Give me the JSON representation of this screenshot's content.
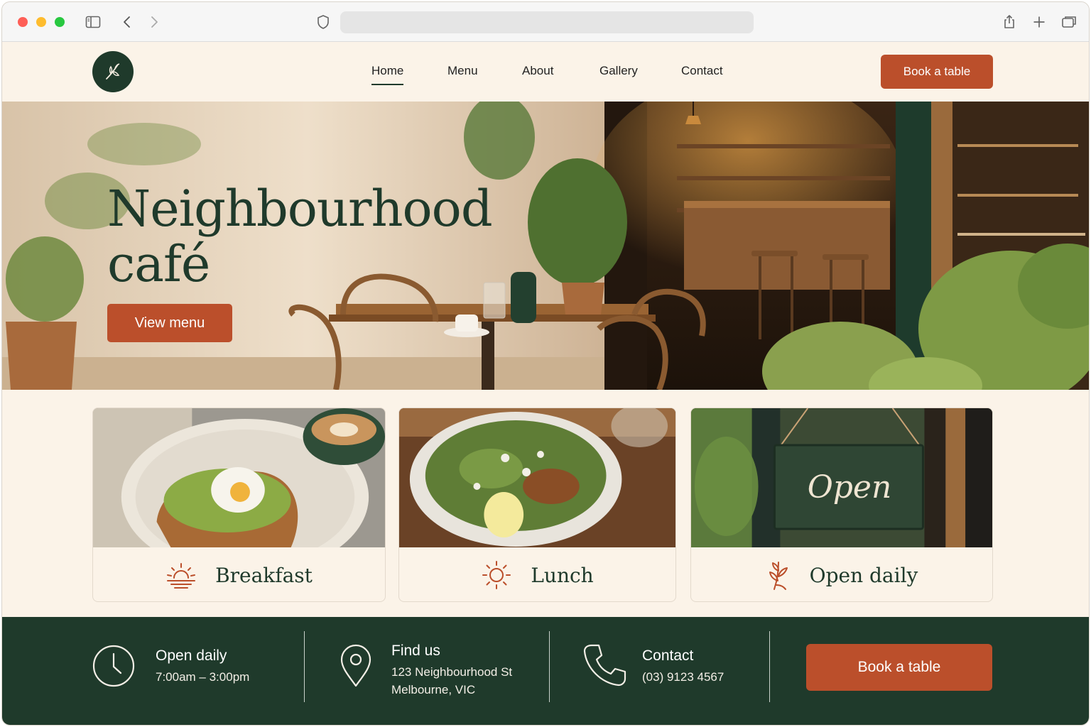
{
  "nav": {
    "items": [
      {
        "label": "Home",
        "active": true
      },
      {
        "label": "Menu",
        "active": false
      },
      {
        "label": "About",
        "active": false
      },
      {
        "label": "Gallery",
        "active": false
      },
      {
        "label": "Contact",
        "active": false
      }
    ],
    "book_label": "Book a table"
  },
  "hero": {
    "title_line1": "Neighbourhood",
    "title_line2": "café",
    "cta_label": "View menu"
  },
  "cards": [
    {
      "label": "Breakfast",
      "icon": "sunrise-icon"
    },
    {
      "label": "Lunch",
      "icon": "sun-icon"
    },
    {
      "label": "Open daily",
      "icon": "leaf-icon"
    }
  ],
  "card_images": {
    "open_sign_text": "Open"
  },
  "info": {
    "hours": {
      "title": "Open daily",
      "text": "7:00am – 3:00pm",
      "icon": "clock-icon"
    },
    "location": {
      "title": "Find us",
      "line1": "123 Neighbourhood St",
      "line2": "Melbourne, VIC",
      "icon": "map-pin-icon"
    },
    "contact": {
      "title": "Contact",
      "text": "(03) 9123 4567",
      "icon": "phone-icon"
    },
    "book_label": "Book a table"
  },
  "colors": {
    "accent": "#bb4f2b",
    "brand_green": "#1f3a2b",
    "background": "#fbf3e8"
  }
}
